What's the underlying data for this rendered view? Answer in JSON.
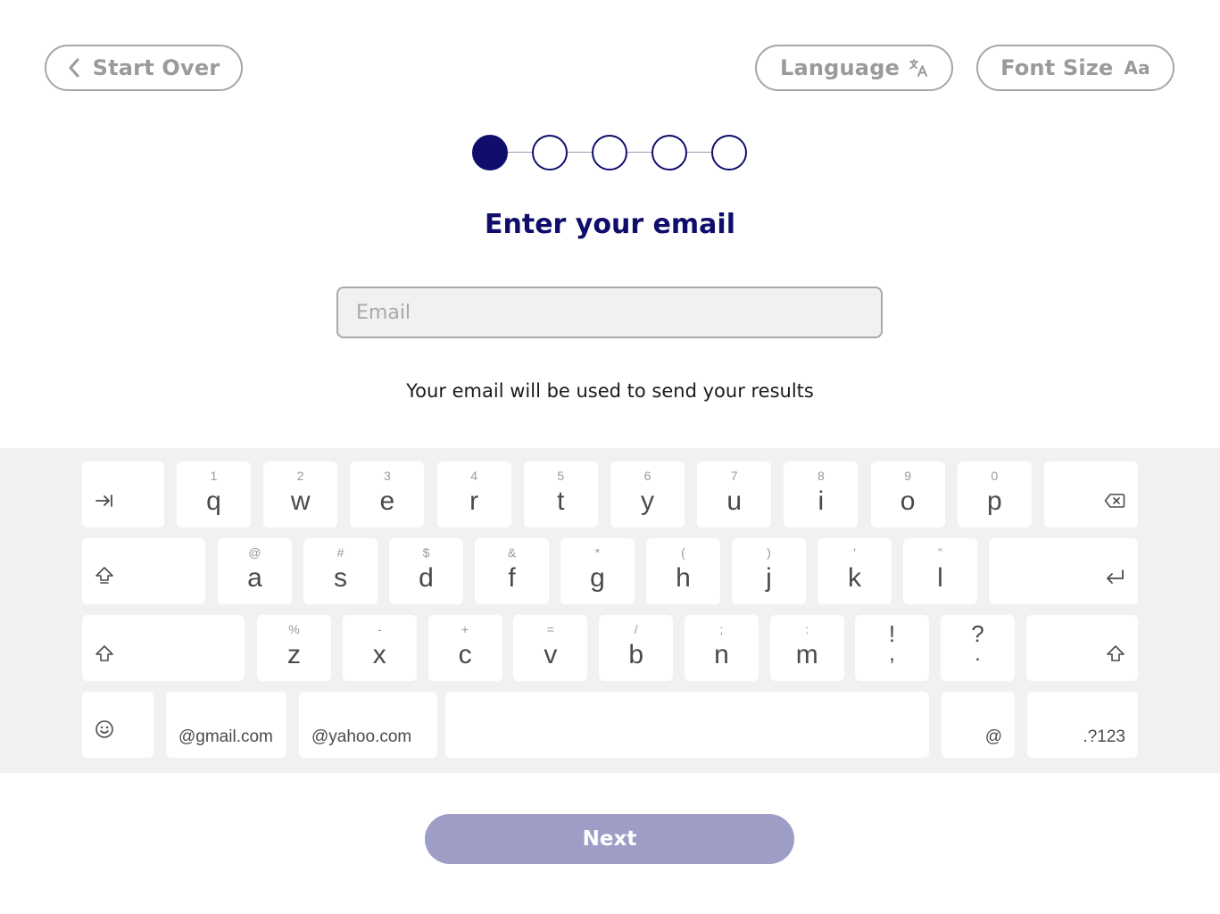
{
  "header": {
    "start_over_label": "Start Over",
    "language_label": "Language",
    "font_size_label": "Font Size",
    "font_size_icon_text": "Aa"
  },
  "stepper": {
    "total_steps": 5,
    "current_step": 1
  },
  "main": {
    "title": "Enter your email",
    "email_placeholder": "Email",
    "email_value": "",
    "helper_text": "Your email will be used to send your results"
  },
  "keyboard": {
    "row1": [
      {
        "main": "q",
        "sec": "1"
      },
      {
        "main": "w",
        "sec": "2"
      },
      {
        "main": "e",
        "sec": "3"
      },
      {
        "main": "r",
        "sec": "4"
      },
      {
        "main": "t",
        "sec": "5"
      },
      {
        "main": "y",
        "sec": "6"
      },
      {
        "main": "u",
        "sec": "7"
      },
      {
        "main": "i",
        "sec": "8"
      },
      {
        "main": "o",
        "sec": "9"
      },
      {
        "main": "p",
        "sec": "0"
      }
    ],
    "row2": [
      {
        "main": "a",
        "sec": "@"
      },
      {
        "main": "s",
        "sec": "#"
      },
      {
        "main": "d",
        "sec": "$"
      },
      {
        "main": "f",
        "sec": "&"
      },
      {
        "main": "g",
        "sec": "*"
      },
      {
        "main": "h",
        "sec": "("
      },
      {
        "main": "j",
        "sec": ")"
      },
      {
        "main": "k",
        "sec": "'"
      },
      {
        "main": "l",
        "sec": "\""
      }
    ],
    "row3": [
      {
        "main": "z",
        "sec": "%"
      },
      {
        "main": "x",
        "sec": "-"
      },
      {
        "main": "c",
        "sec": "+"
      },
      {
        "main": "v",
        "sec": "="
      },
      {
        "main": "b",
        "sec": "/"
      },
      {
        "main": "n",
        "sec": ";"
      },
      {
        "main": "m",
        "sec": ":"
      }
    ],
    "row3_punct": [
      {
        "main": ",",
        "sec": "!"
      },
      {
        "main": ".",
        "sec": "?"
      }
    ],
    "gmail_label": "@gmail.com",
    "yahoo_label": "@yahoo.com",
    "at_label": "@",
    "numbers_label": ".?123"
  },
  "footer": {
    "next_label": "Next"
  },
  "colors": {
    "brand_navy": "#0f0e6d",
    "next_disabled": "#9e9dc6",
    "keyboard_bg": "#f1f1f1",
    "border_gray": "#a6a6a6"
  },
  "icons": {
    "start_over": "chevron-left-icon",
    "language": "translate-icon",
    "tab": "tab-icon",
    "backspace": "backspace-icon",
    "caps": "caps-lock-icon",
    "enter": "enter-icon",
    "shift": "shift-icon",
    "emoji": "emoji-icon"
  }
}
